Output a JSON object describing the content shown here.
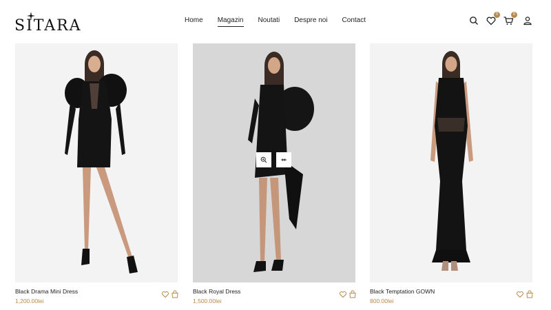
{
  "brand": {
    "name": "SITARA"
  },
  "nav": [
    {
      "label": "Home",
      "active": false
    },
    {
      "label": "Magazin",
      "active": true
    },
    {
      "label": "Noutati",
      "active": false
    },
    {
      "label": "Despre noi",
      "active": false
    },
    {
      "label": "Contact",
      "active": false
    }
  ],
  "header_icons": {
    "search": "search-icon",
    "wishlist": "heart-icon",
    "wishlist_count": "0",
    "cart": "cart-icon",
    "cart_count": "0",
    "account": "user-icon"
  },
  "accent_color": "#b8894c",
  "products": [
    {
      "name": "Black Drama Mini Dress",
      "price": "1,200.00lei"
    },
    {
      "name": "Black Royal Dress",
      "price": "1,500.00lei"
    },
    {
      "name": "Black Temptation GOWN",
      "price": "800.00lei"
    }
  ]
}
